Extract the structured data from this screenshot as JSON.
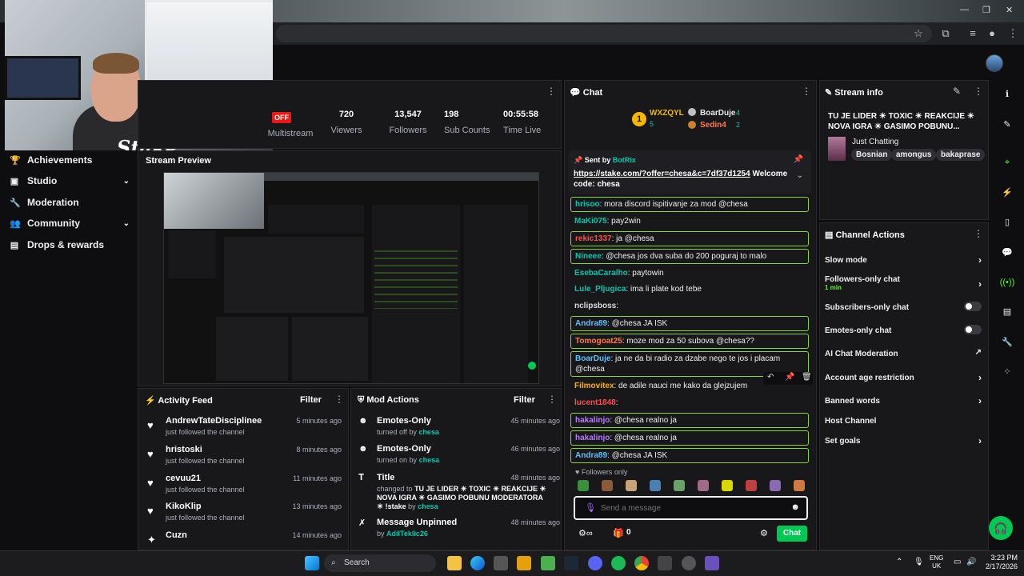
{
  "nav": {
    "items": [
      {
        "label": "Achievements"
      },
      {
        "label": "Studio"
      },
      {
        "label": "Moderation"
      },
      {
        "label": "Community"
      },
      {
        "label": "Drops & rewards"
      }
    ]
  },
  "webcam": {
    "overlay_logo": "Stake"
  },
  "stats": {
    "status_badge": "OFF",
    "multistream_label": "Multistream",
    "viewers": {
      "value": "720",
      "label": "Viewers"
    },
    "followers": {
      "value": "13,547",
      "label": "Followers"
    },
    "subs": {
      "value": "198",
      "label": "Sub Counts"
    },
    "time": {
      "value": "00:55:58",
      "label": "Time Live"
    }
  },
  "preview": {
    "title": "Stream Preview"
  },
  "activity_feed": {
    "title": "Activity Feed",
    "filter_label": "Filter",
    "items": [
      {
        "name": "AndrewTateDisciplinee",
        "sub": "just followed the channel",
        "time": "5 minutes ago"
      },
      {
        "name": "hristoski",
        "sub": "just followed the channel",
        "time": "8 minutes ago"
      },
      {
        "name": "cevuu21",
        "sub": "just followed the channel",
        "time": "11 minutes ago"
      },
      {
        "name": "KikoKlip",
        "sub": "just followed the channel",
        "time": "13 minutes ago"
      },
      {
        "name": "Cuzn",
        "sub": "",
        "time": "14 minutes ago"
      }
    ]
  },
  "mod_actions": {
    "title": "Mod Actions",
    "filter_label": "Filter",
    "items": [
      {
        "name": "Emotes-Only",
        "pre": "turned off by",
        "by": "chesa",
        "time": "45 minutes ago"
      },
      {
        "name": "Emotes-Only",
        "pre": "turned on by",
        "by": "chesa",
        "time": "46 minutes ago"
      },
      {
        "name": "Title",
        "pre": "changed to",
        "detail": "TU JE LIDER ☀ TOXIC ☀ REAKCIJE ☀ NOVA IGRA ☀ GASIMO POBUNU MODERATORA ☀ !stake",
        "mid": "by",
        "by": "chesa",
        "time": "48 minutes ago"
      },
      {
        "name": "Message Unpinned",
        "pre": "by",
        "by": "AdilTeklic26",
        "time": "48 minutes ago"
      }
    ]
  },
  "chat": {
    "title": "Chat",
    "leaderboard": {
      "first": {
        "name": "WXZQYL",
        "count": "5"
      },
      "second": {
        "name": "BoarDuje",
        "count": "4"
      },
      "third": {
        "name": "Sedin4",
        "count": "2"
      }
    },
    "pinned": {
      "sent_by_label": "Sent by",
      "sender": "BotRix",
      "link": "https://stake.com/?offer=chesa&c=7df37d1254",
      "text": "Welcome code: chesa"
    },
    "messages": [
      {
        "user": "hrisoo",
        "text": ": mora discord ispitivanje za mod @chesa",
        "color": "#00c8af"
      },
      {
        "user": "MaKi075",
        "text": ": pay2win",
        "color": "#00c8af"
      },
      {
        "user": "rekic1337",
        "text": ": ja @chesa",
        "color": "#ff4d4d"
      },
      {
        "user": "Nineee",
        "text": ": @chesa jos dva suba do 200 poguraj to malo",
        "color": "#00c8af"
      },
      {
        "user": "EsebaCaralho",
        "text": ": paytowin",
        "color": "#00c8af"
      },
      {
        "user": "Lule_Pljugica",
        "text": ": ima li plate kod tebe",
        "color": "#00c8af"
      },
      {
        "user": "nclipsboss",
        "text": ":",
        "color": "#dcdcdc"
      },
      {
        "user": "Andra89",
        "text": ": @chesa JA ISK",
        "color": "#5bc0ff"
      },
      {
        "user": "Tomogoat25",
        "text": ": moze mod za 50 subova @chesa??",
        "color": "#ff7a4d"
      },
      {
        "user": "BoarDuje",
        "text": ": ja ne da bi radio za dzabe nego te jos i placam @chesa",
        "color": "#5bc0ff"
      },
      {
        "user": "Filmovitex",
        "text": ": de adile nauci me kako da glejzujem",
        "color": "#ffb000"
      },
      {
        "user": "lucent1848",
        "text": ":",
        "color": "#ff4d4d"
      },
      {
        "user": "hakalinjo",
        "text": ": @chesa realno ja",
        "color": "#b77cff"
      },
      {
        "user": "hakalinjo",
        "text": ": @chesa realno ja",
        "color": "#b77cff"
      },
      {
        "user": "Andra89",
        "text": ": @chesa JA ISK",
        "color": "#5bc0ff"
      }
    ],
    "mode_label": "Followers only",
    "input_placeholder": "Send a message",
    "points": "0",
    "send_label": "Chat"
  },
  "stream_info": {
    "title": "Stream info",
    "stream_title": "TU JE LIDER ☀ TOXIC ☀ REAKCIJE ☀ NOVA IGRA ☀ GASIMO POBUNU...",
    "category": "Just Chatting",
    "tags": [
      "Bosnian",
      "amongus",
      "bakaprase"
    ]
  },
  "channel_actions": {
    "title": "Channel Actions",
    "items": [
      {
        "label": "Slow mode"
      },
      {
        "label": "Followers-only chat",
        "sub": "1 min"
      },
      {
        "label": "Subscribers-only chat"
      },
      {
        "label": "Emotes-only chat"
      },
      {
        "label": "AI Chat Moderation"
      },
      {
        "label": "Account age restriction"
      },
      {
        "label": "Banned words"
      },
      {
        "label": "Host Channel"
      },
      {
        "label": "Set goals"
      }
    ]
  },
  "taskbar": {
    "search_label": "Search",
    "lang_top": "ENG",
    "lang_bottom": "UK",
    "time": "3:23 PM",
    "date": "2/17/2026"
  },
  "colors": {
    "accent": "#53fc18",
    "brand_green": "#00c853",
    "highlight_border": "#8cd43c",
    "offline_red": "#e91916"
  }
}
